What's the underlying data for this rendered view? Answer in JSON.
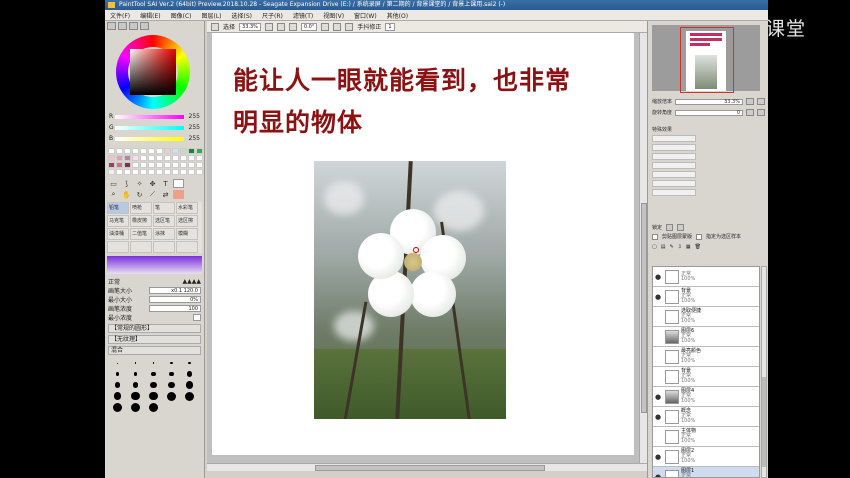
{
  "window_title": "PaintTool SAI Ver.2 (64bit) Preview.2018.10.28 - Seagate Expansion Drive (E:) / 系统录屏 / 第二期的 / 背景课堂的 / 背景上课用.sai2 (-)",
  "menu": [
    "文件(F)",
    "编辑(E)",
    "图像(C)",
    "图层(L)",
    "选择(S)",
    "尺子(R)",
    "滤镜(T)",
    "视图(V)",
    "窗口(W)",
    "其他(O)"
  ],
  "watermark": "腾讯课堂",
  "colors": {
    "accent": "#8b1212",
    "titlebar": "#3a6ea5",
    "selection": "#cfdcef"
  },
  "color_panel": {
    "rgb": [
      {
        "label": "R",
        "value": "255"
      },
      {
        "label": "G",
        "value": "255"
      },
      {
        "label": "B",
        "value": "255"
      }
    ]
  },
  "toolbar": {
    "select_label": "选择",
    "zoom": "33.3%",
    "rotation": "0.0°",
    "stabilizer_label": "手抖修正",
    "stabilizer_value": "1"
  },
  "brush_tools": [
    "铅笔",
    "喷枪",
    "笔",
    "水彩笔",
    "马克笔",
    "橡皮擦",
    "选区笔",
    "选区擦",
    "油漆桶",
    "二值笔",
    "涂抹",
    "模糊",
    "",
    "",
    "",
    ""
  ],
  "brush_props": {
    "mode": "正常",
    "size_label": "画笔大小",
    "size_mult": "x0.1",
    "size_value": "120.0",
    "min_size_label": "最小大小",
    "min_size_value": "0%",
    "density_label": "画笔浓度",
    "density_value": "100",
    "min_density_label": "最小浓度",
    "shape_label": "【常规的圆形】",
    "texture_label": "【无纹理】",
    "blend_label": "混合"
  },
  "brush_dot_sizes": [
    "1",
    "1.5",
    "2",
    "2.3",
    "2.6",
    "3",
    "3.5",
    "4",
    "5",
    "6",
    "7",
    "8",
    "9",
    "10",
    "12",
    "14",
    "16",
    "20",
    "25",
    "30",
    "35",
    "40",
    "50"
  ],
  "canvas": {
    "line1": "能让人一眼就能看到，也非常",
    "line2": "明显的物体"
  },
  "right_panel": {
    "zoom_label": "缩放倍率",
    "zoom_value": "33.3%",
    "angle_label": "旋转角度",
    "angle_value": "0",
    "effects_label": "特殊效果",
    "lock_label": "锁定",
    "clip_label": "剪贴图层蒙版",
    "ref_label": "指定为选区样本"
  },
  "layers": [
    {
      "name": "",
      "mode": "正常",
      "opacity": "100%",
      "eye": true,
      "thumb": "white",
      "selected": false
    },
    {
      "name": "背景",
      "mode": "正常",
      "opacity": "100%",
      "eye": true,
      "thumb": "white",
      "selected": false
    },
    {
      "name": "选取便捷",
      "mode": "正常",
      "opacity": "100%",
      "eye": false,
      "thumb": "white",
      "selected": false
    },
    {
      "name": "图层6",
      "mode": "正常",
      "opacity": "100%",
      "eye": false,
      "thumb": "dark",
      "selected": false
    },
    {
      "name": "最亮颜色",
      "mode": "正常",
      "opacity": "100%",
      "eye": false,
      "thumb": "white",
      "selected": false
    },
    {
      "name": "背景",
      "mode": "正常",
      "opacity": "100%",
      "eye": false,
      "thumb": "white",
      "selected": false
    },
    {
      "name": "图层4",
      "mode": "正常",
      "opacity": "100%",
      "eye": true,
      "thumb": "dark",
      "selected": false
    },
    {
      "name": "概念",
      "mode": "正常",
      "opacity": "100%",
      "eye": true,
      "thumb": "white",
      "selected": false
    },
    {
      "name": "主体物",
      "mode": "正常",
      "opacity": "100%",
      "eye": false,
      "thumb": "white",
      "selected": false
    },
    {
      "name": "图层2",
      "mode": "正常",
      "opacity": "100%",
      "eye": true,
      "thumb": "white",
      "selected": false
    },
    {
      "name": "图层1",
      "mode": "正常",
      "opacity": "100%",
      "eye": true,
      "thumb": "white",
      "selected": true
    }
  ]
}
